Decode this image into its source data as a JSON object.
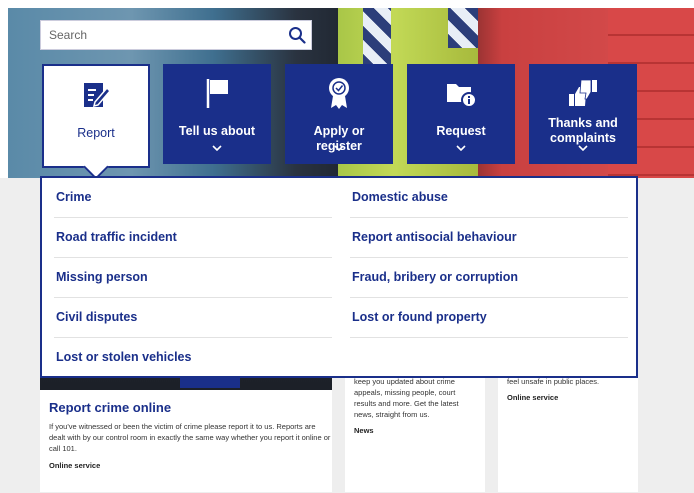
{
  "search": {
    "placeholder": "Search"
  },
  "tiles": [
    {
      "label": "Report",
      "icon": "report-form-icon",
      "active": true
    },
    {
      "label": "Tell us about",
      "icon": "flag-icon",
      "active": false
    },
    {
      "label": "Apply or register",
      "icon": "award-ribbon-icon",
      "active": false
    },
    {
      "label": "Request",
      "icon": "folder-info-icon",
      "active": false
    },
    {
      "label": "Thanks and complaints",
      "icon": "thumbs-up-down-icon",
      "active": false
    }
  ],
  "dropdown": {
    "left": [
      "Crime",
      "Road traffic incident",
      "Missing person",
      "Civil disputes",
      "Lost or stolen vehicles"
    ],
    "right": [
      "Domestic abuse",
      "Report antisocial behaviour",
      "Fraud, bribery or corruption",
      "Lost or found property"
    ]
  },
  "cards": {
    "card1": {
      "title": "Report crime online",
      "desc": "If you've witnessed or been the victim of crime please report it to us. Reports are dealt with by our control room in exactly the same way whether you report it online or call 101.",
      "tag": "Online service"
    },
    "card2": {
      "desc": "keep you updated about crime appeals, missing people, court results and more. Get the latest news, straight from us.",
      "tag": "News"
    },
    "card3": {
      "desc": "feel unsafe in public places.",
      "tag": "Online service"
    }
  },
  "colors": {
    "brand": "#1a2f8a",
    "white": "#ffffff"
  }
}
